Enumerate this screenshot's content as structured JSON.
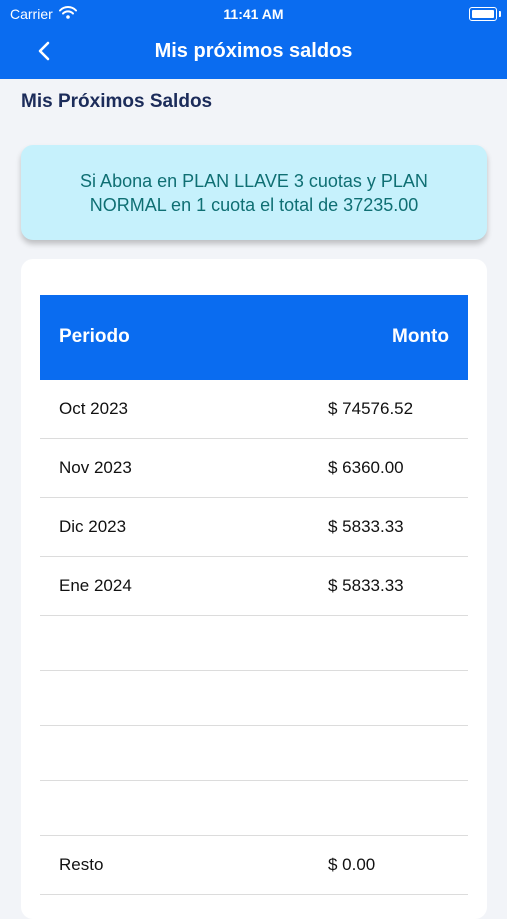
{
  "status_bar": {
    "carrier": "Carrier",
    "time": "11:41 AM"
  },
  "header": {
    "title": "Mis próximos saldos"
  },
  "section": {
    "title": "Mis Próximos Saldos"
  },
  "banner": {
    "text": "Si Abona en PLAN LLAVE 3 cuotas y PLAN NORMAL en 1 cuota el total de 37235.00"
  },
  "table": {
    "headers": {
      "period": "Periodo",
      "amount": "Monto"
    },
    "rows": [
      {
        "period": "Oct 2023",
        "amount": "$ 74576.52"
      },
      {
        "period": "Nov 2023",
        "amount": "$ 6360.00"
      },
      {
        "period": "Dic 2023",
        "amount": "$ 5833.33"
      },
      {
        "period": "Ene 2024",
        "amount": "$ 5833.33"
      }
    ],
    "resto": {
      "period": "Resto",
      "amount": "$ 0.00"
    }
  },
  "colors": {
    "primary": "#0a6cf0",
    "banner_bg": "#c6f1fc",
    "banner_text": "#0f6f73",
    "title_text": "#1c2c5a"
  }
}
